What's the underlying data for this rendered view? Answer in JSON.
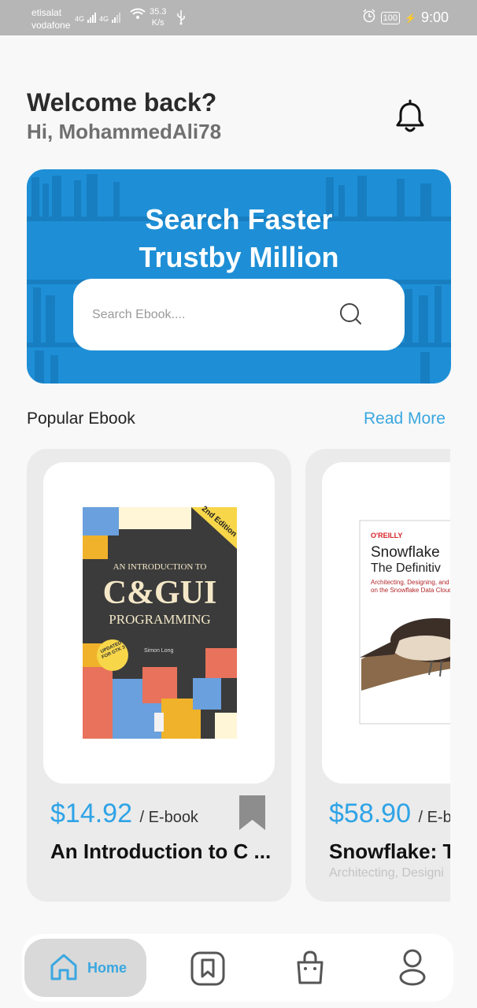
{
  "status_bar": {
    "carrier_1": "etisalat",
    "carrier_2": "vodafone",
    "net_1": "4G",
    "net_2": "4G",
    "speed_value": "35.3",
    "speed_unit": "K/s",
    "battery": "100",
    "time": "9:00"
  },
  "header": {
    "welcome": "Welcome back?",
    "greeting": "Hi, MohammedAli78"
  },
  "banner": {
    "title_line1": "Search Faster",
    "title_line2": "Trustby Million",
    "search_placeholder": "Search Ebook...."
  },
  "section": {
    "title": "Popular Ebook",
    "action": "Read More"
  },
  "books": [
    {
      "price": "$14.92",
      "unit": "/ E-book",
      "title": "An Introduction to C ...",
      "subtitle": "",
      "cover": {
        "edition": "2nd Edition",
        "line1": "AN INTRODUCTION TO",
        "line2": "C&GUI",
        "line3": "PROGRAMMING",
        "badge": "UPDATED FOR GTK 3",
        "author": "Simon Long"
      }
    },
    {
      "price": "$58.90",
      "unit": "/ E-bo",
      "title": "Snowflake: T",
      "subtitle": "Architecting, Designi",
      "cover": {
        "publisher": "O'REILLY",
        "line1": "Snowflake",
        "line2": "The Definitiv",
        "line3": "Architecting, Designing, and D",
        "line4": "on the Snowflake Data Cloud"
      }
    }
  ],
  "nav": {
    "home": "Home"
  },
  "colors": {
    "accent": "#3aa7e0",
    "banner": "#1e8fd6",
    "card": "#ebebeb"
  }
}
